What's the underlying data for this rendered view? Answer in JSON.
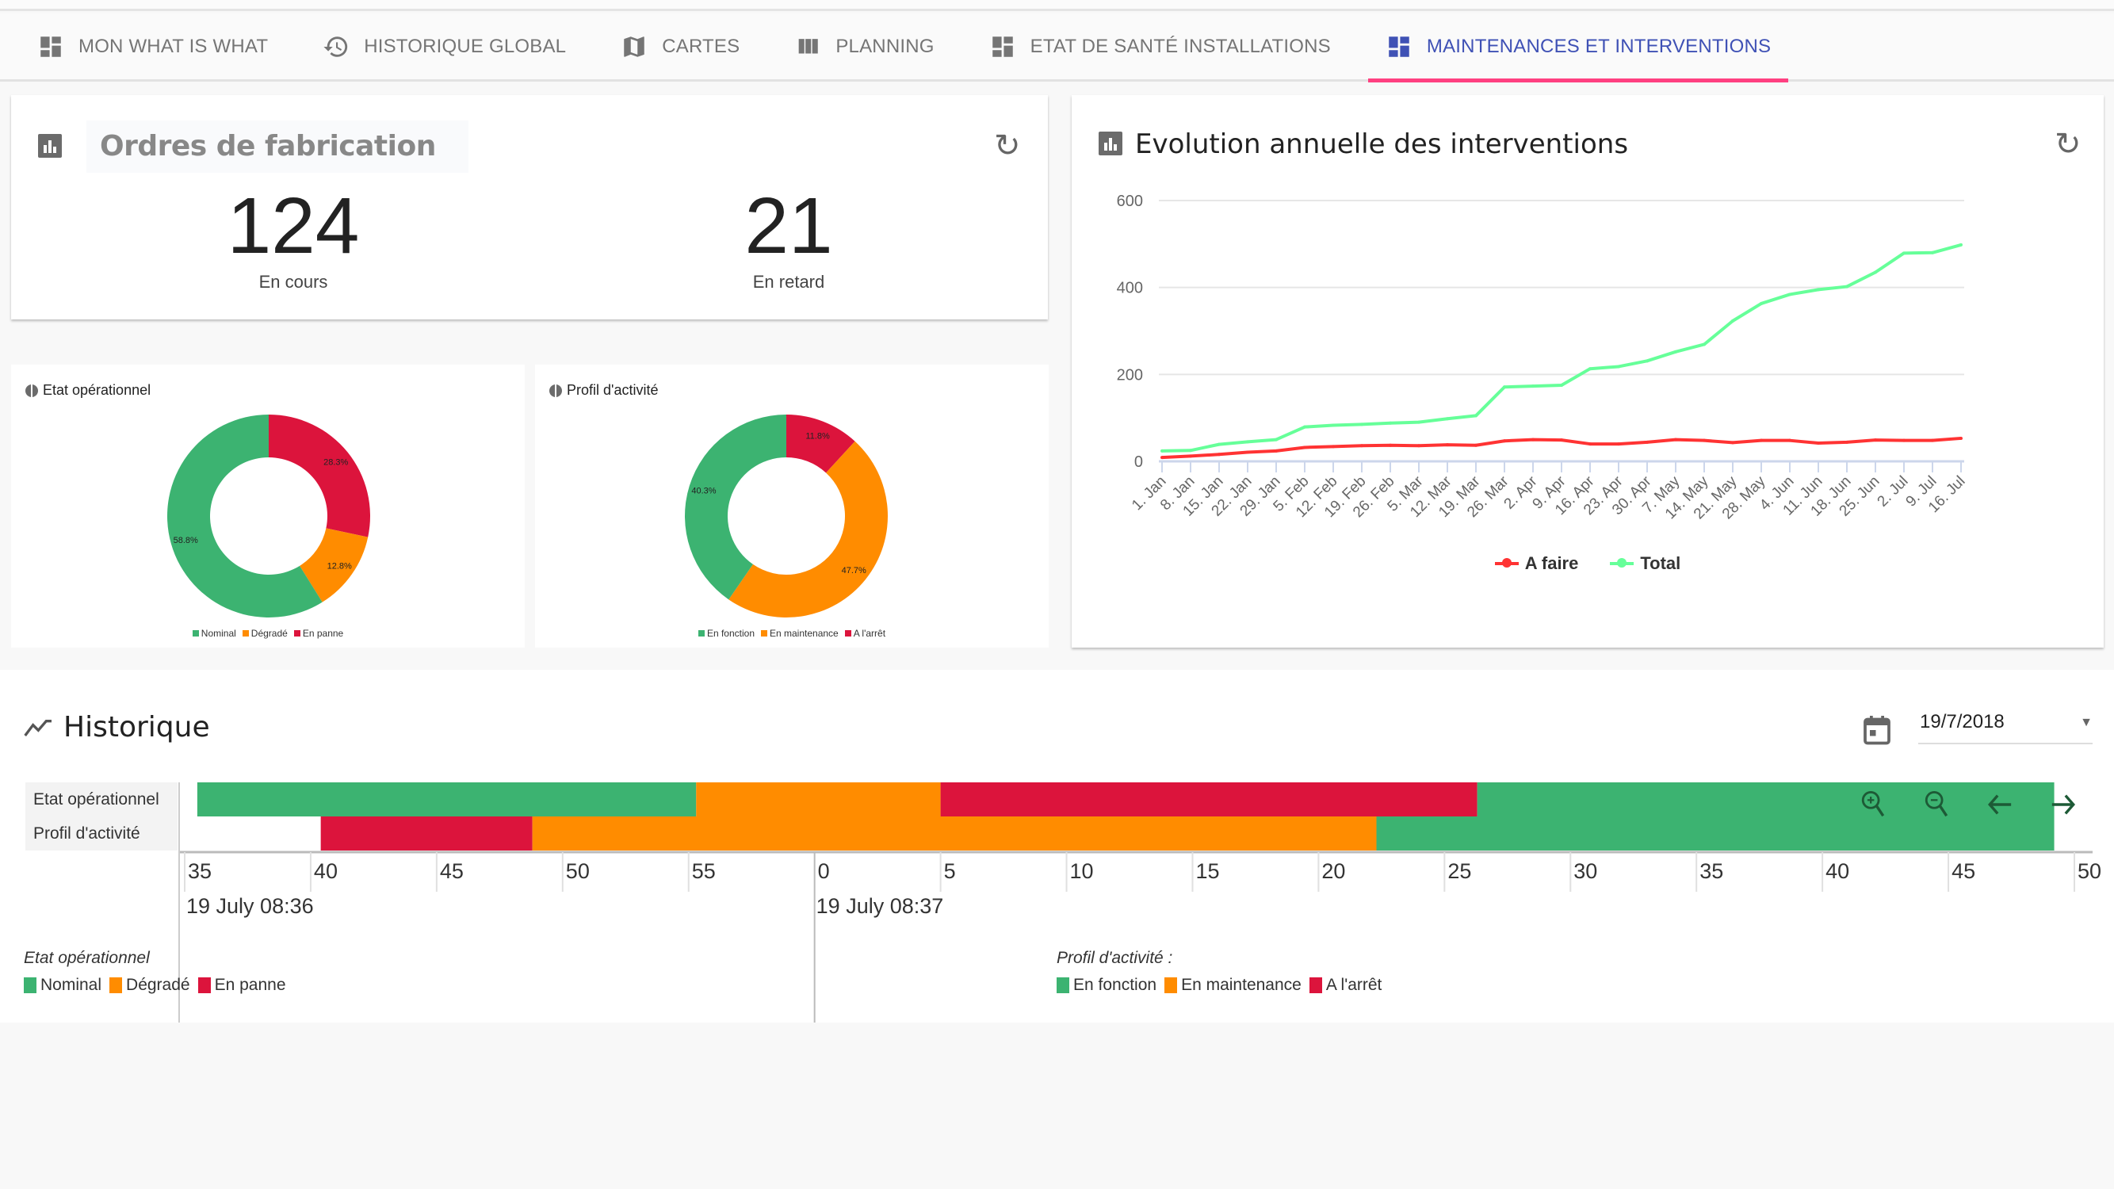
{
  "tabs": [
    {
      "label": "MON WHAT IS WHAT",
      "icon": "dashboard-icon",
      "active": false
    },
    {
      "label": "HISTORIQUE GLOBAL",
      "icon": "history-icon",
      "active": false
    },
    {
      "label": "CARTES",
      "icon": "map-icon",
      "active": false
    },
    {
      "label": "PLANNING",
      "icon": "view-column-icon",
      "active": false
    },
    {
      "label": "ETAT DE SANTÉ INSTALLATIONS",
      "icon": "dashboard-icon",
      "active": false
    },
    {
      "label": "MAINTENANCES ET INTERVENTIONS",
      "icon": "dashboard-icon",
      "active": true
    }
  ],
  "colors": {
    "accent": "#3f51b5",
    "tab_indicator": "#ff4081",
    "green": "#3cb371",
    "orange": "#ff8c00",
    "red": "#dc143c",
    "line_afaire": "#ff3333",
    "line_total": "#66ff99"
  },
  "ordres": {
    "title": "Ordres de fabrication",
    "kpis": [
      {
        "value": "124",
        "label": "En cours"
      },
      {
        "value": "21",
        "label": "En retard"
      }
    ]
  },
  "chart_data": [
    {
      "type": "pie",
      "title": "Etat opérationnel",
      "labels": [
        "Nominal",
        "Dégradé",
        "En panne"
      ],
      "values": [
        58.8,
        12.8,
        28.3
      ],
      "value_labels": [
        "58.8%",
        "12.8%",
        "28.3%"
      ],
      "colors": [
        "#3cb371",
        "#ff8c00",
        "#dc143c"
      ],
      "legend": "bottom"
    },
    {
      "type": "pie",
      "title": "Profil d'activité",
      "labels": [
        "En fonction",
        "En maintenance",
        "A l'arrêt"
      ],
      "values": [
        40.3,
        47.7,
        11.8
      ],
      "value_labels": [
        "40.3%",
        "47.7%",
        "11.8%"
      ],
      "colors": [
        "#3cb371",
        "#ff8c00",
        "#dc143c"
      ],
      "legend": "bottom"
    },
    {
      "type": "line",
      "title": "Evolution annuelle des interventions",
      "x": [
        "1. Jan",
        "8. Jan",
        "15. Jan",
        "22. Jan",
        "29. Jan",
        "5. Feb",
        "12. Feb",
        "19. Feb",
        "26. Feb",
        "5. Mar",
        "12. Mar",
        "19. Mar",
        "26. Mar",
        "2. Apr",
        "9. Apr",
        "16. Apr",
        "23. Apr",
        "30. Apr",
        "7. May",
        "14. May",
        "21. May",
        "28. May",
        "4. Jun",
        "11. Jun",
        "18. Jun",
        "25. Jun",
        "2. Jul",
        "9. Jul",
        "16. Jul"
      ],
      "series": [
        {
          "name": "A faire",
          "color": "#ff3333",
          "values": [
            9,
            12,
            16,
            21,
            24,
            32,
            34,
            36,
            37,
            36,
            38,
            37,
            47,
            50,
            49,
            40,
            40,
            44,
            50,
            48,
            43,
            48,
            48,
            42,
            44,
            49,
            48,
            48,
            53
          ]
        },
        {
          "name": "Total",
          "color": "#66ff99",
          "values": [
            24,
            25,
            39,
            45,
            50,
            79,
            83,
            85,
            88,
            90,
            98,
            105,
            171,
            173,
            175,
            213,
            218,
            231,
            252,
            269,
            323,
            363,
            384,
            395,
            402,
            435,
            479,
            480,
            498
          ]
        }
      ],
      "yticks": [
        "0",
        "200",
        "400",
        "600"
      ],
      "ylim": [
        0,
        600
      ],
      "grid": true,
      "legend": "bottom"
    },
    {
      "type": "timeline",
      "title": "Historique",
      "rows": [
        "Etat opérationnel",
        "Profil d'activité"
      ],
      "x_unit": "seconds from 19 July 08:36:00",
      "xlim": [
        35,
        110
      ],
      "ticks": [
        "35",
        "40",
        "45",
        "50",
        "55",
        "0",
        "5",
        "10",
        "15",
        "20",
        "25",
        "30",
        "35",
        "40",
        "45",
        "50"
      ],
      "major_labels": [
        {
          "at": 35,
          "label": "19 July 08:36"
        },
        {
          "at": 60,
          "label": "19 July 08:37"
        }
      ],
      "segments": [
        {
          "row": 0,
          "start": 35.5,
          "end": 55.3,
          "state": "Nominal",
          "color": "#3cb371"
        },
        {
          "row": 0,
          "start": 55.3,
          "end": 65.0,
          "state": "Dégradé",
          "color": "#ff8c00"
        },
        {
          "row": 0,
          "start": 65.0,
          "end": 86.3,
          "state": "En panne",
          "color": "#dc143c"
        },
        {
          "row": 0,
          "start": 86.3,
          "end": 110.0,
          "state": "Nominal",
          "color": "#3cb371"
        },
        {
          "row": 1,
          "start": 40.4,
          "end": 48.8,
          "state": "A l'arrêt",
          "color": "#dc143c"
        },
        {
          "row": 1,
          "start": 48.8,
          "end": 82.3,
          "state": "En maintenance",
          "color": "#ff8c00"
        },
        {
          "row": 1,
          "start": 82.3,
          "end": 110.0,
          "state": "En fonction",
          "color": "#3cb371"
        }
      ]
    }
  ],
  "evolution": {
    "title": "Evolution annuelle des interventions",
    "legend": [
      "A faire",
      "Total"
    ]
  },
  "historique": {
    "title": "Historique",
    "date": "19/7/2018",
    "row_labels": [
      "Etat opérationnel",
      "Profil d'activité"
    ],
    "controls": [
      "zoom-in",
      "zoom-out",
      "move-left",
      "move-right"
    ],
    "legend_etat": {
      "caption": "Etat opérationnel",
      "items": [
        "Nominal",
        "Dégradé",
        "En panne"
      ]
    },
    "legend_profil": {
      "caption": "Profil d'activité :",
      "items": [
        "En fonction",
        "En maintenance",
        "A l'arrêt"
      ]
    }
  }
}
